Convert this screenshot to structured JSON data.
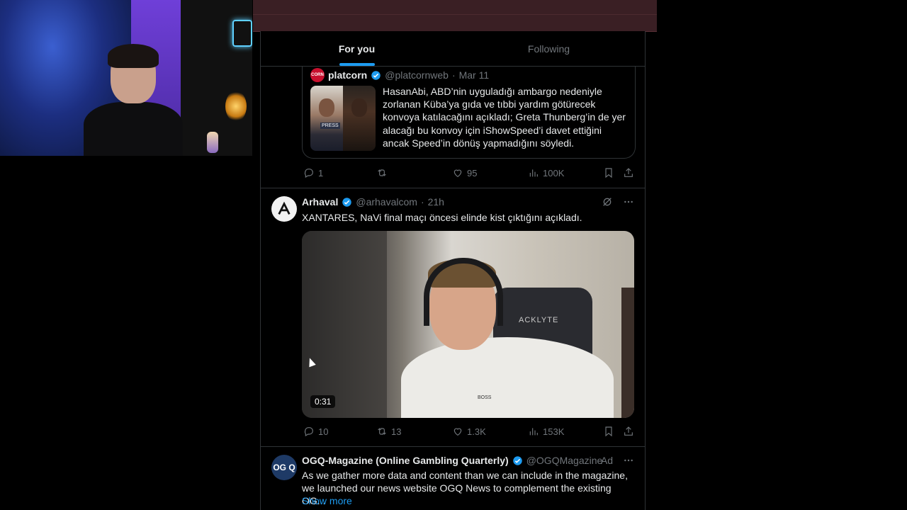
{
  "tabs": [
    {
      "label": "For you",
      "active": true
    },
    {
      "label": "Following",
      "active": false
    }
  ],
  "tweet1": {
    "quote": {
      "avatar_text": "CORN",
      "name": "platcorn",
      "handle": "@platcornweb",
      "sep": "·",
      "date": "Mar 11",
      "thumb_badge": "PRESS",
      "text": "HasanAbi, ABD’nin uyguladığı ambargo nedeniyle zorlanan Küba’ya gıda ve tıbbi yardım götürecek konvoya katılacağını açıkladı; Greta Thunberg’in de yer alacağı bu konvoy için iShowSpeed’i davet ettiğini ancak Speed’in dönüş yapmadığını söyledi."
    },
    "actions": {
      "replies": "1",
      "reposts": "",
      "likes": "95",
      "views": "100K"
    }
  },
  "tweet2": {
    "name": "Arhaval",
    "handle": "@arhavalcom",
    "sep": "·",
    "time": "21h",
    "text": "XANTARES, NaVi final maçı öncesi elinde kist çıktığını açıkladı.",
    "video_duration": "0:31",
    "video_brand": "ACKLYTE",
    "shirt_text": "BOSS",
    "actions": {
      "replies": "10",
      "reposts": "13",
      "likes": "1.3K",
      "views": "153K"
    }
  },
  "tweet3": {
    "avatar_text": "OG Q",
    "name": "OGQ-Magazine (Online Gambling Quarterly)",
    "handle": "@OGQMagazine",
    "ad_label": "Ad",
    "text": "As we gather more data and content than we can include in the magazine, we launched our news website OGQ News to complement the existing OG...",
    "show_more": "Show more"
  },
  "colors": {
    "accent": "#1d9bf0",
    "text": "#e7e9ea",
    "muted": "#71767b",
    "border": "#2f3336"
  }
}
